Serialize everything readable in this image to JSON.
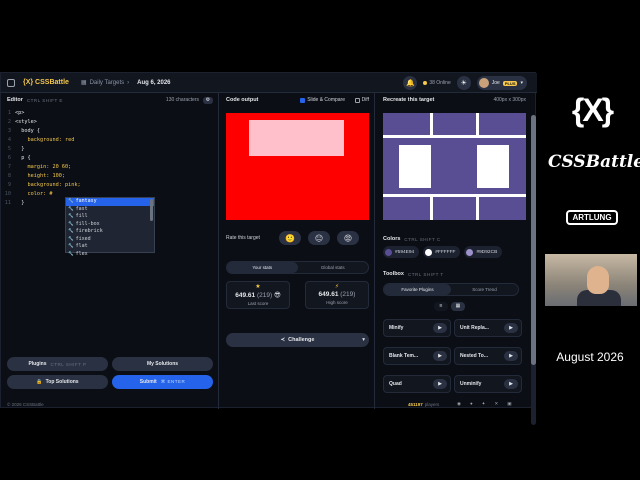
{
  "topbar": {
    "app_title": "{X} CSSBattle",
    "crumb": "Daily Targets",
    "date": "Aug 6, 2026",
    "online": "38 Online",
    "user": "Joe",
    "plus": "PLUS"
  },
  "editor": {
    "title": "Editor",
    "shortcut": "CTRL SHIFT E",
    "chars": "130 characters",
    "lines": [
      {
        "n": "1",
        "text": "<p>",
        "cls": "tag"
      },
      {
        "n": "2",
        "text": "<style>",
        "cls": "tag"
      },
      {
        "n": "3",
        "text": "  body {",
        "cls": "sel"
      },
      {
        "n": "4",
        "text": "    background: red",
        "cls": "prop"
      },
      {
        "n": "5",
        "text": "  }",
        "cls": "sel"
      },
      {
        "n": "6",
        "text": "  p {",
        "cls": "sel"
      },
      {
        "n": "7",
        "text": "    margin: 20 60;",
        "cls": "prop"
      },
      {
        "n": "8",
        "text": "    height: 100;",
        "cls": "prop"
      },
      {
        "n": "9",
        "text": "    background: pink;",
        "cls": "prop"
      },
      {
        "n": "10",
        "text": "    color: #",
        "cls": "prop"
      },
      {
        "n": "11",
        "text": "  }",
        "cls": "sel"
      }
    ],
    "autocomplete": [
      "fantasy",
      "fast",
      "fill",
      "fill-box",
      "firebrick",
      "fixed",
      "flat",
      "flex"
    ],
    "plugins_label": "Plugins",
    "plugins_kbd": "CTRL SHIFT P",
    "my_solutions": "My Solutions",
    "top_solutions": "Top Solutions",
    "submit": "Submit",
    "submit_kbd": "⌘ ENTER"
  },
  "output": {
    "title": "Code output",
    "slide_compare": "Slide & Compare",
    "diff": "Diff",
    "rate_label": "Rate this target",
    "rate_emojis": [
      "🙂",
      "😐",
      "😡"
    ],
    "tab_your": "Your stats",
    "tab_global": "Global stats",
    "last_score": "649.61",
    "last_chars": "(219)",
    "last_label": "Last score",
    "high_score": "649.61",
    "high_chars": "(219)",
    "high_label": "High score",
    "challenge": "Challenge"
  },
  "target": {
    "title": "Recreate this target",
    "size": "400px x 300px",
    "colors_title": "Colors",
    "colors_kbd": "CTRL SHIFT C",
    "colors": [
      {
        "hex": "#594E94",
        "color": "#594e94"
      },
      {
        "hex": "#FFFFFF",
        "color": "#ffffff"
      },
      {
        "hex": "#9D92CB",
        "color": "#9d92cb"
      }
    ],
    "toolbox_title": "Toolbox",
    "toolbox_kbd": "CTRL SHIFT T",
    "tab_plugins": "Favorite Plugins",
    "tab_trend": "Score Trend",
    "tools": [
      "Minify",
      "Unit Repla...",
      "Blank Tem...",
      "Nested To...",
      "Quad",
      "Unminify"
    ]
  },
  "footer": {
    "copyright": "© 2026 CSSBattle",
    "players": "451197",
    "players_label": "players"
  },
  "brand": {
    "logo": "{X}",
    "name": "CSSBattle",
    "partner": "ARTLUNG",
    "month": "August 2026"
  }
}
